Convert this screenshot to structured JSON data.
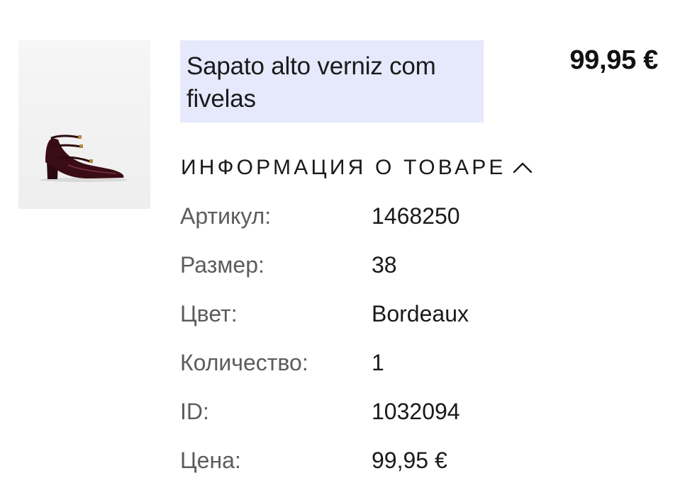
{
  "product": {
    "image_alt": "shoe-thumbnail",
    "title": "Sapato alto verniz com fivelas",
    "price": "99,95 €",
    "highlight_color": "#e6e9fb"
  },
  "info_section": {
    "title": "ИНФОРМАЦИЯ О ТОВАРЕ",
    "toggle_icon": "chevron-up-icon",
    "specs": [
      {
        "label": "Артикул:",
        "value": "1468250"
      },
      {
        "label": "Размер:",
        "value": "38"
      },
      {
        "label": "Цвет:",
        "value": "Bordeaux"
      },
      {
        "label": "Количество:",
        "value": "1"
      },
      {
        "label": "ID:",
        "value": "1032094"
      },
      {
        "label": "Цена:",
        "value": "99,95 €"
      }
    ]
  }
}
